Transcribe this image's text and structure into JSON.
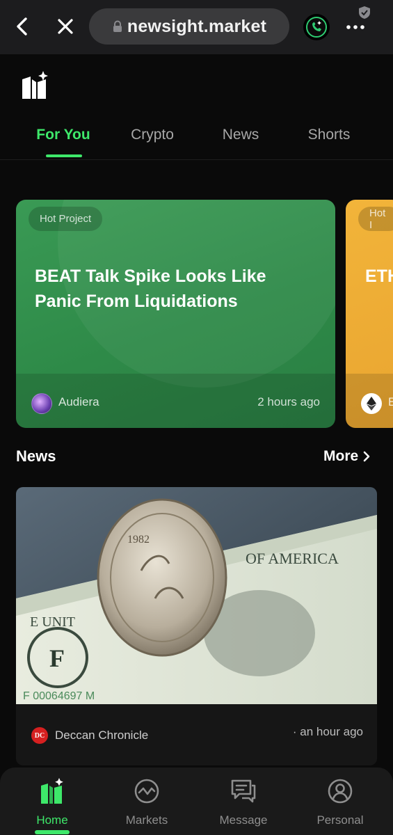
{
  "browser": {
    "url": "newsight.market",
    "back_icon": "chevron-left-icon",
    "close_icon": "close-icon",
    "lock_icon": "lock-icon",
    "call_icon": "phone-call-icon",
    "menu_icon": "more-horizontal-icon",
    "shield_icon": "shield-icon"
  },
  "app": {
    "logo_icon": "newsight-logo-icon"
  },
  "tabs": [
    {
      "label": "For You",
      "active": true
    },
    {
      "label": "Crypto",
      "active": false
    },
    {
      "label": "News",
      "active": false
    },
    {
      "label": "Shorts",
      "active": false
    }
  ],
  "carousel": [
    {
      "tag": "Hot Project",
      "title": "BEAT Talk Spike Looks Like Panic From Liquidations",
      "author": "Audiera",
      "time": "2 hours ago",
      "color": "#2e8a48"
    },
    {
      "tag": "Hot I",
      "title": "ETH Lev",
      "author": "E",
      "color": "#efb03a"
    }
  ],
  "news_section": {
    "heading": "News",
    "more_label": "More",
    "items": [
      {
        "image_description_icon": "rupee-coin-dollar-bill-image",
        "source_logo_text": "DC",
        "source": "Deccan Chronicle",
        "time": "· an hour ago"
      }
    ]
  },
  "bottom_nav": [
    {
      "label": "Home",
      "icon": "home-logo-icon",
      "active": true
    },
    {
      "label": "Markets",
      "icon": "markets-icon",
      "active": false
    },
    {
      "label": "Message",
      "icon": "message-icon",
      "active": false
    },
    {
      "label": "Personal",
      "icon": "person-icon",
      "active": false
    }
  ],
  "colors": {
    "accent": "#3ee86a",
    "background": "#0a0a0a",
    "browser_bar": "#1c1c1e"
  }
}
